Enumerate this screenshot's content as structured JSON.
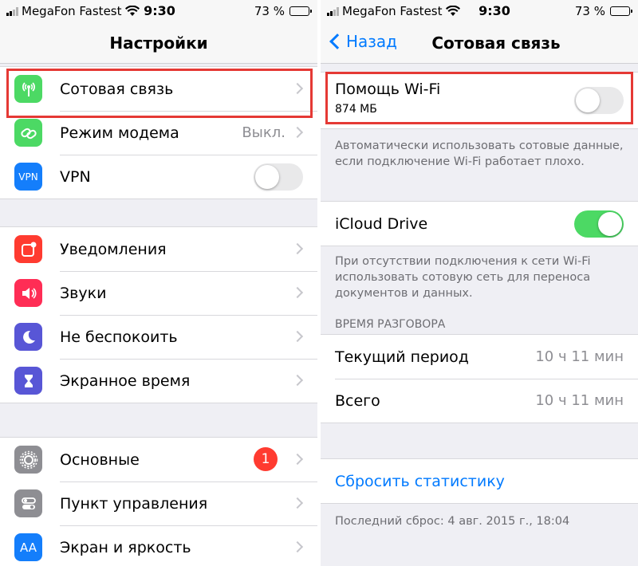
{
  "status": {
    "carrier": "MegaFon Fastest",
    "time": "9:30",
    "battery": "73 %",
    "battery_level": 0.73
  },
  "left": {
    "title": "Настройки",
    "group1": [
      {
        "label": "Сотовая связь",
        "icon": "antenna-icon",
        "color": "#4cd964"
      },
      {
        "label": "Режим модема",
        "icon": "link-chain-icon",
        "color": "#4cd964",
        "value": "Выкл."
      },
      {
        "label": "VPN",
        "icon": "vpn-icon",
        "icon_text": "VPN",
        "color": "#147efb"
      }
    ],
    "group2": [
      {
        "label": "Уведомления",
        "icon": "notifications-icon",
        "color": "#ff3b30"
      },
      {
        "label": "Звуки",
        "icon": "speaker-icon",
        "color": "#ff2d55"
      },
      {
        "label": "Не беспокоить",
        "icon": "moon-icon",
        "color": "#5856d6"
      },
      {
        "label": "Экранное время",
        "icon": "hourglass-icon",
        "color": "#5856d6"
      }
    ],
    "group3": [
      {
        "label": "Основные",
        "icon": "gear-icon",
        "color": "#8e8e93",
        "badge": "1"
      },
      {
        "label": "Пункт управления",
        "icon": "control-center-icon",
        "color": "#8e8e93"
      },
      {
        "label": "Экран и яркость",
        "icon": "text-size-icon",
        "icon_text": "AA",
        "color": "#147efb"
      }
    ]
  },
  "right": {
    "back_label": "Назад",
    "title": "Сотовая связь",
    "wifi_assist": {
      "label": "Помощь Wi-Fi",
      "sublabel": "874 МБ"
    },
    "wifi_assist_note": "Автоматически использовать сотовые данные, если подключение Wi-Fi работает плохо.",
    "icloud": {
      "label": "iCloud Drive"
    },
    "icloud_note": "При отсутствии подключения к сети Wi-Fi использовать сотовую сеть для переноса документов и данных.",
    "call_time_header": "ВРЕМЯ РАЗГОВОРА",
    "current_period": {
      "label": "Текущий период",
      "value": "10 ч 11 мин"
    },
    "total": {
      "label": "Всего",
      "value": "10 ч 11 мин"
    },
    "reset_label": "Сбросить статистику",
    "last_reset": "Последний сброс: 4 авг. 2015 г., 18:04"
  },
  "colors": {
    "accent": "#007aff",
    "toggle_on": "#4cd964",
    "highlight": "#e53935"
  }
}
